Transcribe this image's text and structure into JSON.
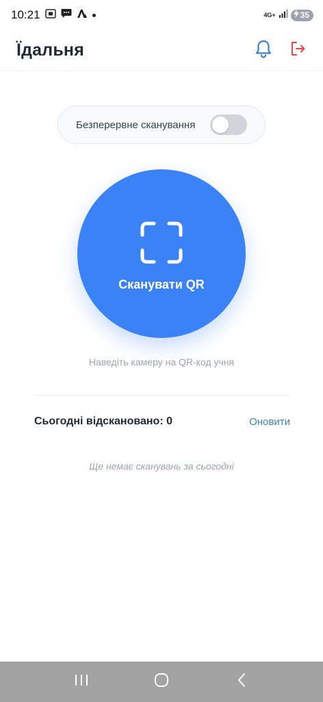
{
  "status_bar": {
    "time": "10:21",
    "network": "4G+",
    "battery": "35"
  },
  "header": {
    "title": "Їдальня",
    "icons": [
      "bell-icon",
      "logout-icon"
    ]
  },
  "toggle": {
    "label": "Безперервне сканування",
    "on": false
  },
  "scan": {
    "label": "Сканувати QR",
    "icon": "scan-frame-icon"
  },
  "hint": "Наведіть камеру на QR-код учня",
  "summary": {
    "text": "Сьогодні відскановано: 0",
    "refresh_label": "Оновити"
  },
  "empty_text": "Ще немає сканувань за сьогодні",
  "colors": {
    "accent": "#3b82f6",
    "logout": "#ef4444",
    "link": "#3b82c4"
  }
}
